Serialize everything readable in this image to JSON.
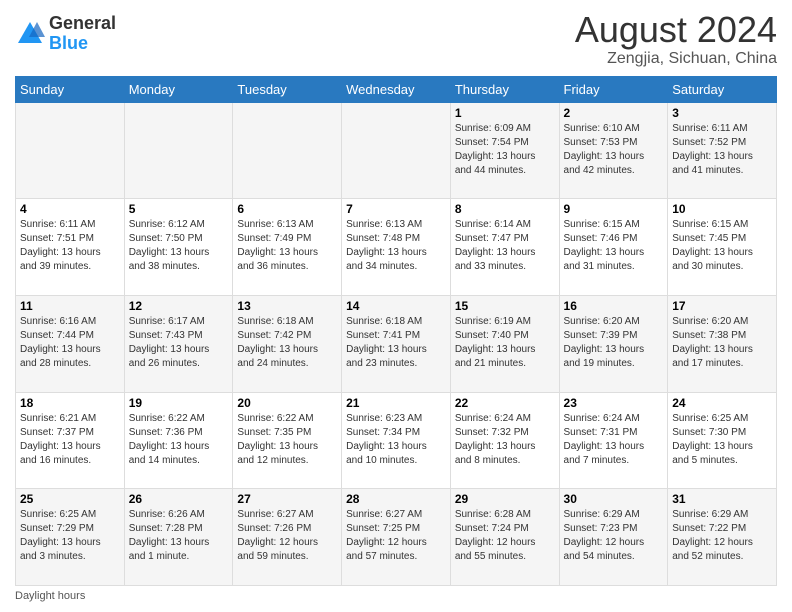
{
  "header": {
    "logo_general": "General",
    "logo_blue": "Blue",
    "title": "August 2024",
    "subtitle": "Zengjia, Sichuan, China"
  },
  "calendar": {
    "days_of_week": [
      "Sunday",
      "Monday",
      "Tuesday",
      "Wednesday",
      "Thursday",
      "Friday",
      "Saturday"
    ],
    "weeks": [
      [
        {
          "day": "",
          "info": ""
        },
        {
          "day": "",
          "info": ""
        },
        {
          "day": "",
          "info": ""
        },
        {
          "day": "",
          "info": ""
        },
        {
          "day": "1",
          "info": "Sunrise: 6:09 AM\nSunset: 7:54 PM\nDaylight: 13 hours and 44 minutes."
        },
        {
          "day": "2",
          "info": "Sunrise: 6:10 AM\nSunset: 7:53 PM\nDaylight: 13 hours and 42 minutes."
        },
        {
          "day": "3",
          "info": "Sunrise: 6:11 AM\nSunset: 7:52 PM\nDaylight: 13 hours and 41 minutes."
        }
      ],
      [
        {
          "day": "4",
          "info": "Sunrise: 6:11 AM\nSunset: 7:51 PM\nDaylight: 13 hours and 39 minutes."
        },
        {
          "day": "5",
          "info": "Sunrise: 6:12 AM\nSunset: 7:50 PM\nDaylight: 13 hours and 38 minutes."
        },
        {
          "day": "6",
          "info": "Sunrise: 6:13 AM\nSunset: 7:49 PM\nDaylight: 13 hours and 36 minutes."
        },
        {
          "day": "7",
          "info": "Sunrise: 6:13 AM\nSunset: 7:48 PM\nDaylight: 13 hours and 34 minutes."
        },
        {
          "day": "8",
          "info": "Sunrise: 6:14 AM\nSunset: 7:47 PM\nDaylight: 13 hours and 33 minutes."
        },
        {
          "day": "9",
          "info": "Sunrise: 6:15 AM\nSunset: 7:46 PM\nDaylight: 13 hours and 31 minutes."
        },
        {
          "day": "10",
          "info": "Sunrise: 6:15 AM\nSunset: 7:45 PM\nDaylight: 13 hours and 30 minutes."
        }
      ],
      [
        {
          "day": "11",
          "info": "Sunrise: 6:16 AM\nSunset: 7:44 PM\nDaylight: 13 hours and 28 minutes."
        },
        {
          "day": "12",
          "info": "Sunrise: 6:17 AM\nSunset: 7:43 PM\nDaylight: 13 hours and 26 minutes."
        },
        {
          "day": "13",
          "info": "Sunrise: 6:18 AM\nSunset: 7:42 PM\nDaylight: 13 hours and 24 minutes."
        },
        {
          "day": "14",
          "info": "Sunrise: 6:18 AM\nSunset: 7:41 PM\nDaylight: 13 hours and 23 minutes."
        },
        {
          "day": "15",
          "info": "Sunrise: 6:19 AM\nSunset: 7:40 PM\nDaylight: 13 hours and 21 minutes."
        },
        {
          "day": "16",
          "info": "Sunrise: 6:20 AM\nSunset: 7:39 PM\nDaylight: 13 hours and 19 minutes."
        },
        {
          "day": "17",
          "info": "Sunrise: 6:20 AM\nSunset: 7:38 PM\nDaylight: 13 hours and 17 minutes."
        }
      ],
      [
        {
          "day": "18",
          "info": "Sunrise: 6:21 AM\nSunset: 7:37 PM\nDaylight: 13 hours and 16 minutes."
        },
        {
          "day": "19",
          "info": "Sunrise: 6:22 AM\nSunset: 7:36 PM\nDaylight: 13 hours and 14 minutes."
        },
        {
          "day": "20",
          "info": "Sunrise: 6:22 AM\nSunset: 7:35 PM\nDaylight: 13 hours and 12 minutes."
        },
        {
          "day": "21",
          "info": "Sunrise: 6:23 AM\nSunset: 7:34 PM\nDaylight: 13 hours and 10 minutes."
        },
        {
          "day": "22",
          "info": "Sunrise: 6:24 AM\nSunset: 7:32 PM\nDaylight: 13 hours and 8 minutes."
        },
        {
          "day": "23",
          "info": "Sunrise: 6:24 AM\nSunset: 7:31 PM\nDaylight: 13 hours and 7 minutes."
        },
        {
          "day": "24",
          "info": "Sunrise: 6:25 AM\nSunset: 7:30 PM\nDaylight: 13 hours and 5 minutes."
        }
      ],
      [
        {
          "day": "25",
          "info": "Sunrise: 6:25 AM\nSunset: 7:29 PM\nDaylight: 13 hours and 3 minutes."
        },
        {
          "day": "26",
          "info": "Sunrise: 6:26 AM\nSunset: 7:28 PM\nDaylight: 13 hours and 1 minute."
        },
        {
          "day": "27",
          "info": "Sunrise: 6:27 AM\nSunset: 7:26 PM\nDaylight: 12 hours and 59 minutes."
        },
        {
          "day": "28",
          "info": "Sunrise: 6:27 AM\nSunset: 7:25 PM\nDaylight: 12 hours and 57 minutes."
        },
        {
          "day": "29",
          "info": "Sunrise: 6:28 AM\nSunset: 7:24 PM\nDaylight: 12 hours and 55 minutes."
        },
        {
          "day": "30",
          "info": "Sunrise: 6:29 AM\nSunset: 7:23 PM\nDaylight: 12 hours and 54 minutes."
        },
        {
          "day": "31",
          "info": "Sunrise: 6:29 AM\nSunset: 7:22 PM\nDaylight: 12 hours and 52 minutes."
        }
      ]
    ]
  },
  "footer": {
    "text": "Daylight hours"
  }
}
